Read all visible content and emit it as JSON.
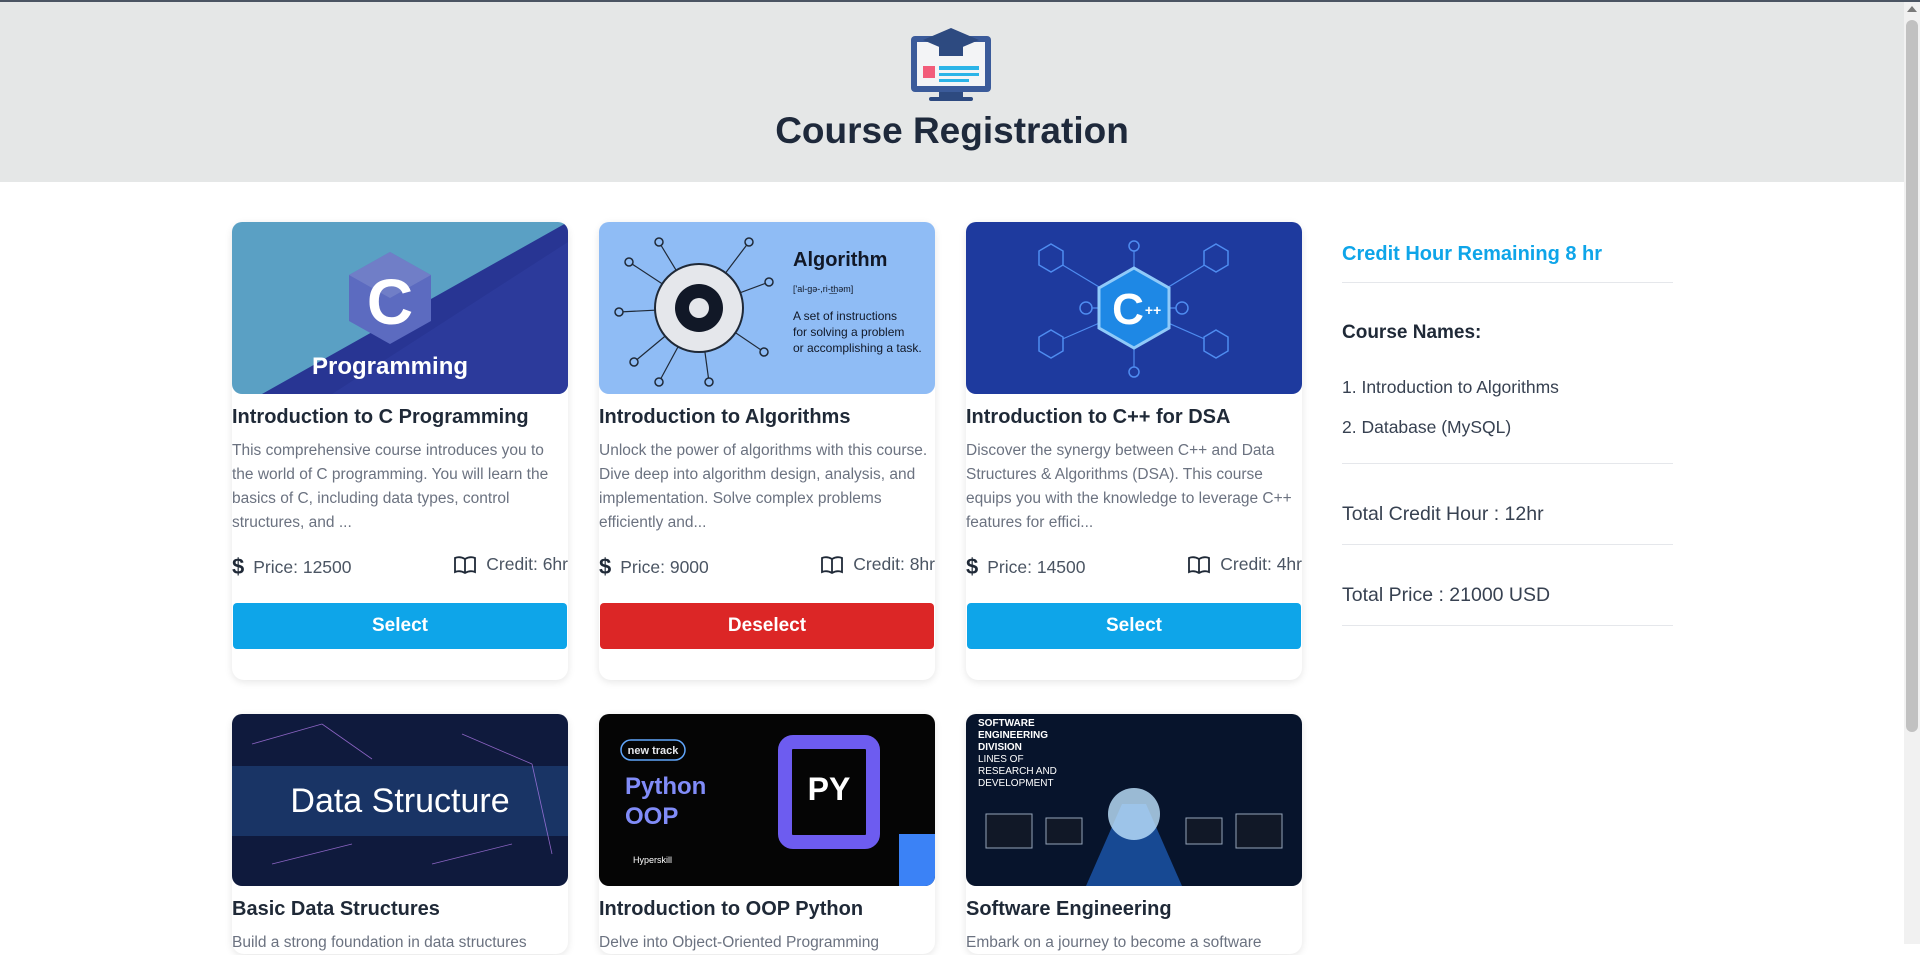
{
  "header": {
    "title": "Course Registration",
    "logo_icon": "graduation-monitor-icon"
  },
  "courses": [
    {
      "title": "Introduction to C Programming",
      "description": "This comprehensive course introduces you to the world of C programming. You will learn the basics of C, including data types, control structures, and ...",
      "price": "Price: 12500",
      "credit": "Credit: 6hr",
      "button": "Select",
      "image_text": "Programming",
      "image_letter": "C"
    },
    {
      "title": "Introduction to Algorithms",
      "description": "Unlock the power of algorithms with this course. Dive deep into algorithm design, analysis, and implementation. Solve complex problems efficiently and...",
      "price": "Price: 9000",
      "credit": "Credit: 8hr",
      "button": "Deselect",
      "image_heading": "Algorithm",
      "image_phonetic": "['al-gə-,ri-t͟həm]",
      "image_line1": "A set of instructions",
      "image_line2": "for solving a problem",
      "image_line3": "or accomplishing a task."
    },
    {
      "title": "Introduction to C++ for DSA",
      "description": "Discover the synergy between C++ and Data Structures & Algorithms (DSA). This course equips you with the knowledge to leverage C++ features for effici...",
      "price": "Price: 14500",
      "credit": "Credit: 4hr",
      "button": "Select",
      "image_letter": "C",
      "image_plus": "++"
    },
    {
      "title": "Basic Data Structures",
      "description": "Build a strong foundation in data structures",
      "image_text": "Data Structure"
    },
    {
      "title": "Introduction to OOP Python",
      "description": "Delve into Object-Oriented Programming",
      "image_badge": "new track",
      "image_line1": "Python",
      "image_line2": "OOP",
      "image_py": "PY",
      "image_brand": "Hyperskill"
    },
    {
      "title": "Software Engineering",
      "description": "Embark on a journey to become a software",
      "image_line1": "SOFTWARE",
      "image_line2": "ENGINEERING",
      "image_line3": "DIVISION",
      "image_line4": "LINES OF",
      "image_line5": "RESEARCH AND",
      "image_line6": "DEVELOPMENT"
    }
  ],
  "sidebar": {
    "remaining": "Credit Hour Remaining 8 hr",
    "course_names_heading": "Course Names:",
    "course_names": [
      "1. Introduction to Algorithms",
      "2. Database (MySQL)"
    ],
    "total_credit": "Total Credit Hour : 12hr",
    "total_price": "Total Price : 21000 USD"
  },
  "colors": {
    "accent": "#0ea5e9",
    "danger": "#dc2626",
    "header_bg": "#e5e7e7"
  }
}
